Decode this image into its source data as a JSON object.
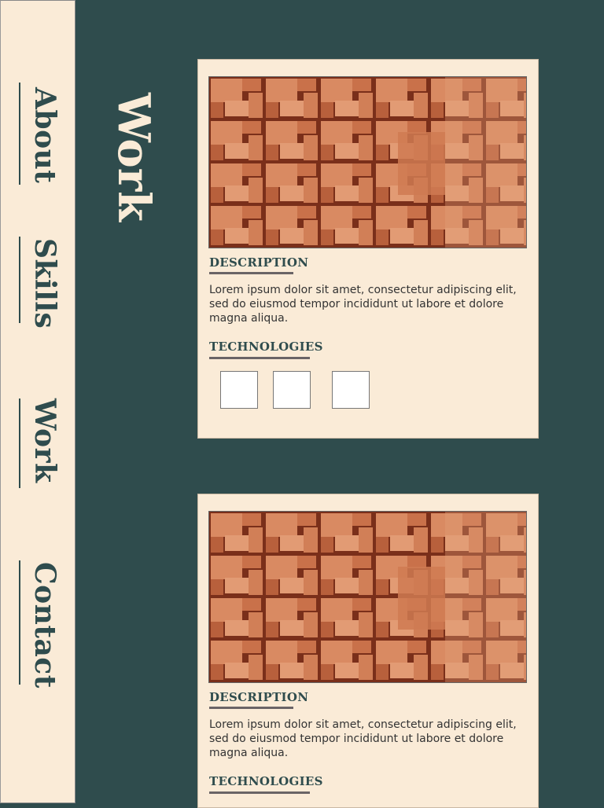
{
  "nav": {
    "items": [
      {
        "label": "About"
      },
      {
        "label": "Skills"
      },
      {
        "label": "Work"
      },
      {
        "label": "Contact"
      }
    ]
  },
  "page": {
    "title": "Work"
  },
  "cards": [
    {
      "image_alt": "terracotta brick wall",
      "description_heading": "DESCRIPTION",
      "description_text": "Lorem ipsum dolor sit amet, consectetur adipiscing elit, sed do eiusmod tempor incididunt ut labore et dolore magna aliqua.",
      "technologies_heading": "TECHNOLOGIES"
    },
    {
      "image_alt": "terracotta brick wall",
      "description_heading": "DESCRIPTION",
      "description_text": "Lorem ipsum dolor sit amet, consectetur adipiscing elit, sed do eiusmod tempor incididunt ut labore et dolore magna aliqua.",
      "technologies_heading": "TECHNOLOGIES"
    }
  ],
  "colors": {
    "background": "#2f4c4d",
    "panel": "#faebd7",
    "accent_text": "#2f4c4d",
    "brick": "#d98a62"
  }
}
